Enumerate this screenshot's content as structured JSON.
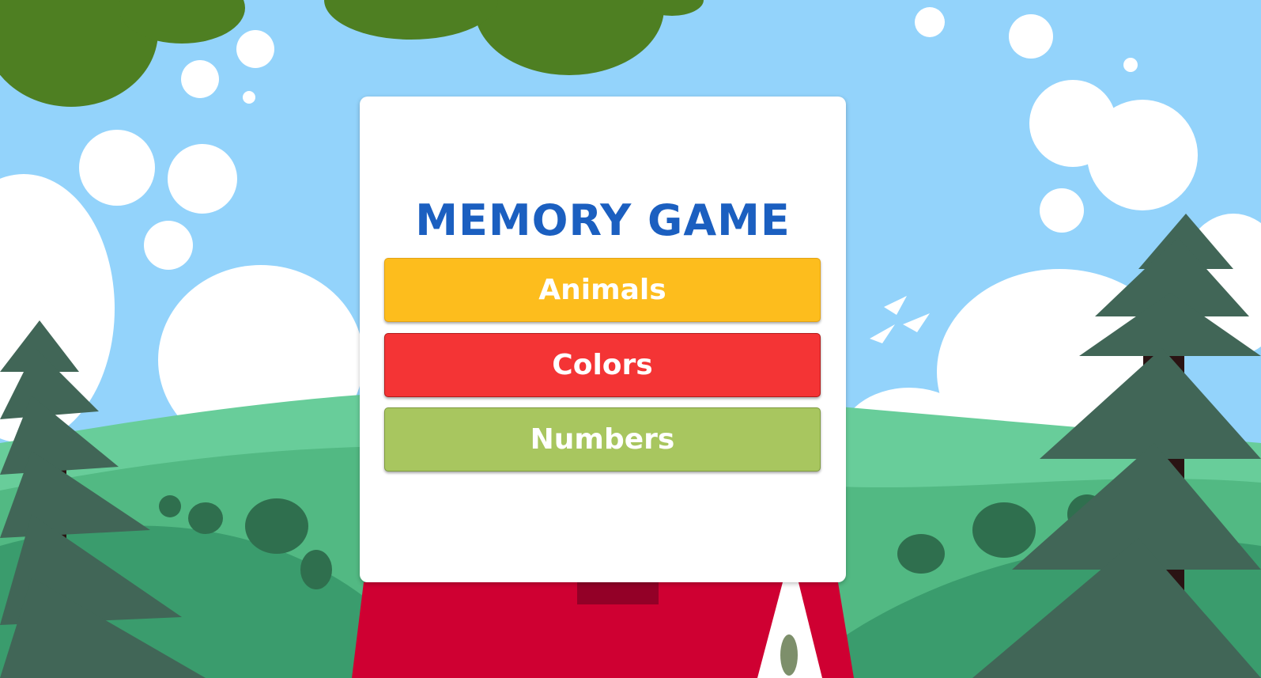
{
  "game": {
    "title": "MEMORY GAME",
    "menu": [
      {
        "label": "Animals",
        "color": "#fdbd1d"
      },
      {
        "label": "Colors",
        "color": "#f43435"
      },
      {
        "label": "Numbers",
        "color": "#a8c65f"
      }
    ]
  },
  "scene": {
    "sky_color": "#93d3fb",
    "hill_colors": [
      "#68cd9a",
      "#52b983",
      "#3a9c6d"
    ],
    "tree_color": "#416657",
    "house_roof_color": "#cf0032",
    "canopy_color": "#4e7f22"
  }
}
